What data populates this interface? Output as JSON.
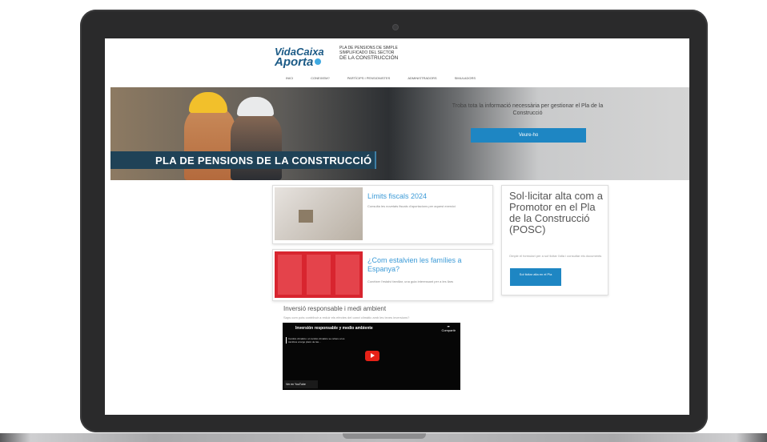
{
  "brand": {
    "logo_top": "VidaCaixa",
    "logo_bottom": "Aporta",
    "plan_lines": [
      "PLA DE PENSIONS DE SIMPLE",
      "SIMPLIFICADO DEL SECTOR",
      "DE LA CONSTRUCCIÓN"
    ]
  },
  "nav": {
    "items": [
      "INICI",
      "CONEIXEM?",
      "PARTÍCIPS I PENSIONISTES",
      "ADMINISTRADORS",
      "SIMULADORS"
    ]
  },
  "hero": {
    "title": "PLA DE PENSIONS DE LA CONSTRUCCIÓ",
    "text": "Troba tota la informació necessària per gestionar el Pla de la Construcció",
    "button": "Veure-ho"
  },
  "cards": [
    {
      "title": "Límits fiscals 2024",
      "desc": "Consulta les novetats fiscals d'aportacions per aquest exercici"
    },
    {
      "title": "¿Com estalvien les famílies a Espanya?",
      "desc": "Conèixer l'estalvi familiar, una guia interessant per a les llars"
    }
  ],
  "side_card": {
    "title": "Sol·licitar alta com a Promotor en el Pla de la Construcció (POSC)",
    "desc": "Omple el formulari per a sol·licitar l'alta i consultar els documents",
    "button": "Sol·licitar alta en el Pla"
  },
  "video": {
    "heading": "Inversió responsable i medi ambient",
    "subheading": "Saps com pots contribuir a reduir els efectes del canvi climàtic amb les teves inversions?",
    "title": "Inversión responsable y medio ambiente",
    "share": "Compartir",
    "overlay": "Cambio climático: el cambio climático se refiere a los cambios a largo plazo de las...",
    "watch_on": "Ver en YouTube"
  },
  "colors": {
    "accent": "#1e86c3",
    "brand": "#1b5a86",
    "hero_title_bg": "#1f4257",
    "link": "#3b9ad7",
    "youtube_red": "#e62117"
  }
}
